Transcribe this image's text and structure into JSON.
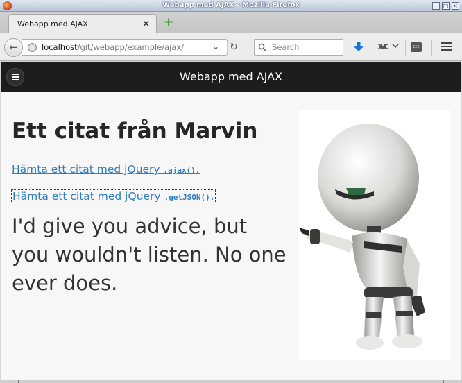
{
  "window": {
    "title": "Webapp med AJAX - Mozilla Firefox",
    "buttons": [
      "minimize",
      "maximize",
      "close"
    ]
  },
  "tabs": [
    {
      "label": "Webapp med AJAX",
      "close_glyph": "×",
      "active": true
    }
  ],
  "new_tab_glyph": "+",
  "toolbar": {
    "back_glyph": "←",
    "url_host": "localhost",
    "url_path": "/git/webapp/example/ajax/",
    "dropdown_glyph": "⌄",
    "reload_glyph": "↻",
    "search_placeholder": "Search",
    "search_glyph": "⚲",
    "zzz_label": "zzz"
  },
  "site": {
    "header_title": "Webapp med AJAX",
    "heading": "Ett citat från Marvin",
    "links": [
      {
        "text": "Hämta ett citat med jQuery ",
        "code": ".ajax()."
      },
      {
        "text": "Hämta ett citat med jQuery ",
        "code": ".getJSON()."
      }
    ],
    "quote": "I'd give you advice, but you wouldn't listen. No one ever does."
  },
  "colors": {
    "site_header_bg": "#1d1d1d",
    "link": "#2f7dbd",
    "page_bg": "#f7f7f7",
    "heading_text": "#262626"
  },
  "icons": {
    "titlebar": "firefox-icon",
    "back": "back-arrow-icon",
    "site_identity": "globe-icon",
    "search": "magnifier-icon",
    "download": "download-arrow-icon",
    "addon": "bug-icon",
    "menu": "hamburger-menu-icon",
    "image": "marvin-robot-image"
  }
}
